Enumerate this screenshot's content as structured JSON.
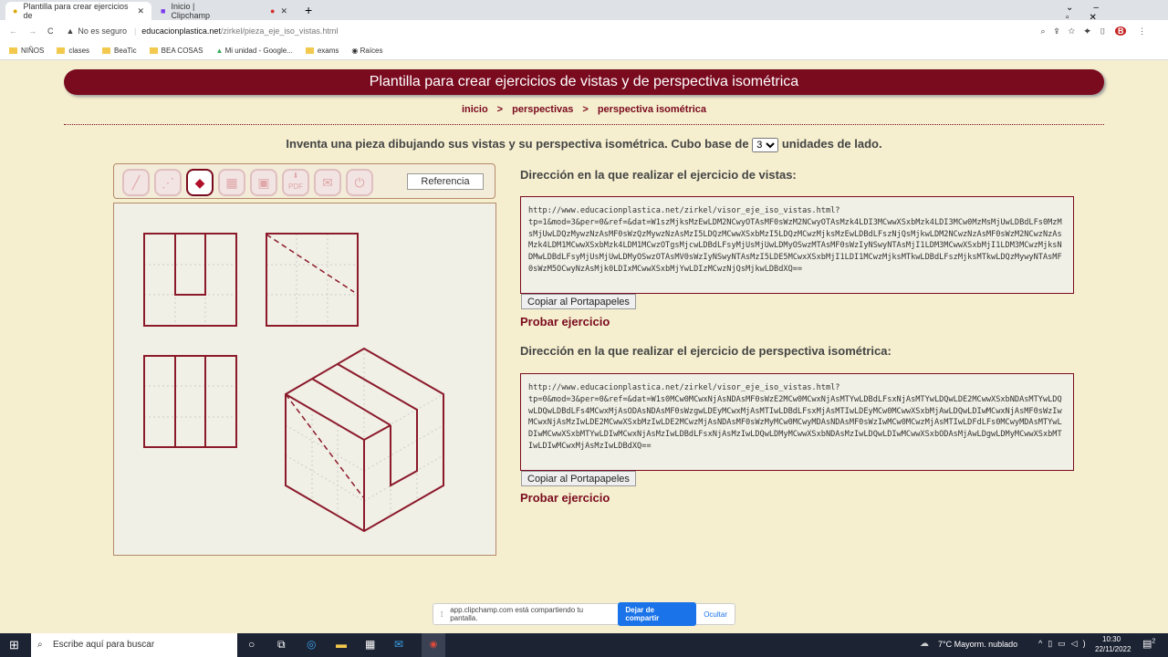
{
  "browser": {
    "tabs": [
      {
        "title": "Plantilla para crear ejercicios de"
      },
      {
        "title": "Inicio | Clipchamp"
      }
    ],
    "security": "No es seguro",
    "url_domain": "educacionplastica.net",
    "url_path": "/zirkel/pieza_eje_iso_vistas.html",
    "bookmarks": [
      "NIÑOS",
      "clases",
      "BeaTic",
      "BEA COSAS",
      "Mi unidad - Google...",
      "exams",
      "Raíces"
    ]
  },
  "page": {
    "title": "Plantilla para crear ejercicios de vistas y de perspectiva isométrica",
    "breadcrumb": [
      "inicio",
      "perspectivas",
      "perspectiva isométrica"
    ],
    "breadcrumb_sep": ">",
    "intro_before": "Inventa una pieza dibujando sus vistas y su perspectiva isométrica. Cubo base de",
    "cube_size": "3",
    "intro_after": "unidades de lado.",
    "toolbar": {
      "tools": [
        "line-tool",
        "dashed-line-tool",
        "eraser-tool",
        "views-tool",
        "camera-tool",
        "pdf-download-tool",
        "email-tool",
        "power-tool"
      ],
      "selected": "eraser-tool",
      "pdf_label": "PDF",
      "reference_label": "Referencia"
    },
    "views_section": {
      "heading": "Dirección en la que realizar el ejercicio de vistas:",
      "url": "http://www.educacionplastica.net/zirkel/visor_eje_iso_vistas.html?\ntp=1&mod=3&per=0&ref=&dat=W1szMjksMzEwLDM2NCwyOTAsMF0sWzM2NCwyOTAsMzk4LDI3MCwwXSxbMzk4LDI3MCw0MzMsMjUwLDBdLFs0MzMsMjUwLDQzMywzNzAsMF0sWzQzMywzNzAsMzI5LDQzMCwwXSxbMzI5LDQzMCwzMjksMzEwLDBdLFszNjQsMjkwLDM2NCwzNzAsMF0sWzM2NCwzNzAsMzk4LDM1MCwwXSxbMzk4LDM1MCwzOTgsMjcwLDBdLFsyMjUsMjUwLDMyOSwzMTAsMF0sWzIyNSwyNTAsMjI1LDM3MCwwXSxbMjI1LDM3MCwzMjksNDMwLDBdLFsyMjUsMjUwLDMyOSwzOTAsMV0sWzIyNSwyNTAsMzI5LDE5MCwxXSxbMjI1LDI1MCwzMjksMTkwLDBdLFszMjksMTkwLDQzMywyNTAsMF0sWzM5OCwyNzAsMjk0LDIxMCwwXSxbMjYwLDIzMCwzNjQsMjkwLDBdXQ==",
      "copy_label": "Copiar al Portapapeles",
      "try_label": "Probar ejercicio"
    },
    "iso_section": {
      "heading": "Dirección en la que realizar el ejercicio de perspectiva isométrica:",
      "url": "http://www.educacionplastica.net/zirkel/visor_eje_iso_vistas.html?\ntp=0&mod=3&per=0&ref=&dat=W1s0MCw0MCwxNjAsNDAsMF0sWzE2MCw0MCwxNjAsMTYwLDBdLFsxNjAsMTYwLDQwLDE2MCwwXSxbNDAsMTYwLDQwLDQwLDBdLFs4MCwxMjAsODAsNDAsMF0sWzgwLDEyMCwxMjAsMTIwLDBdLFsxMjAsMTIwLDEyMCw0MCwwXSxbMjAwLDQwLDIwMCwxNjAsMF0sWzIwMCwxNjAsMzIwLDE2MCwwXSxbMzIwLDE2MCwzMjAsNDAsMF0sWzMyMCw0MCwyMDAsNDAsMF0sWzIwMCw0MCwzMjAsMTIwLDFdLFs0MCwyMDAsMTYwLDIwMCwwXSxbMTYwLDIwMCwxNjAsMzIwLDBdLFsxNjAsMzIwLDQwLDMyMCwwXSxbNDAsMzIwLDQwLDIwMCwwXSxbODAsMjAwLDgwLDMyMCwwXSxbMTIwLDIwMCwxMjAsMzIwLDBdXQ==",
      "copy_label": "Copiar al Portapapeles",
      "try_label": "Probar ejercicio"
    }
  },
  "share_bar": {
    "message": "app.clipchamp.com está compartiendo tu pantalla.",
    "stop_label": "Dejar de compartir",
    "hide_label": "Ocultar"
  },
  "taskbar": {
    "search_placeholder": "Escribe aquí para buscar",
    "weather": "7°C  Mayorm. nublado",
    "time": "10:30",
    "date": "22/11/2022",
    "notifications": "2"
  },
  "colors": {
    "accent": "#7a0a1e",
    "background": "#f5efcf",
    "canvas": "#f1f0e6"
  }
}
